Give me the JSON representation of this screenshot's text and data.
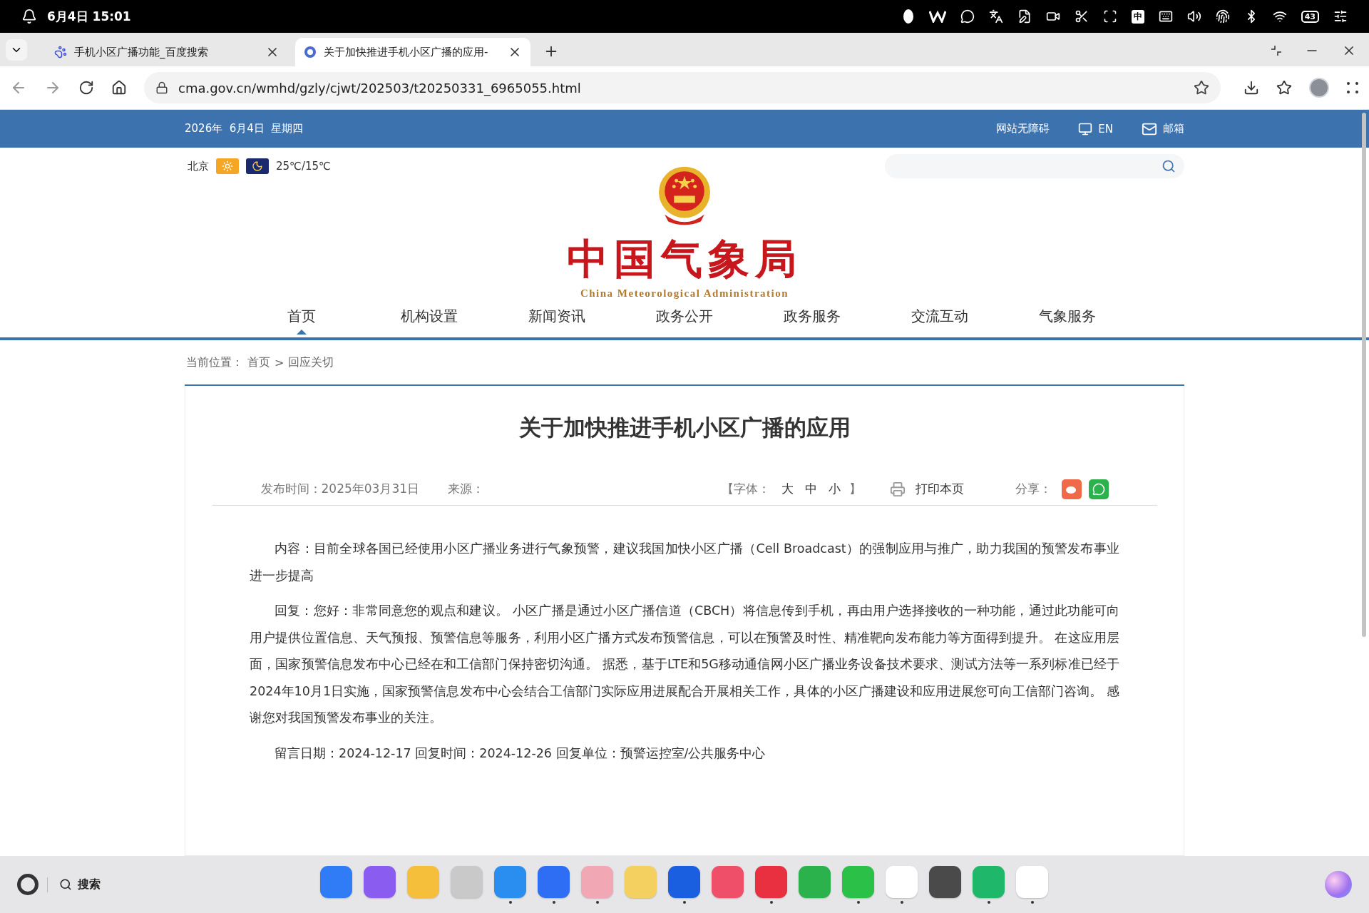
{
  "status_bar": {
    "time": "6月4日 15:01",
    "ime": "中",
    "battery": "43"
  },
  "browser": {
    "tabs": [
      {
        "title": "手机小区广播功能_百度搜索",
        "kind": "paw",
        "selected": false
      },
      {
        "title": "关于加快推进手机小区广播的应用-",
        "kind": "site",
        "selected": true
      }
    ],
    "url": "cma.gov.cn/wmhd/gzly/cjwt/202503/t20250331_6965055.html"
  },
  "site": {
    "date": "2026年  6月4日  星期四",
    "top_links": [
      {
        "label": "网站无障碍",
        "kind": "text"
      },
      {
        "label": "EN",
        "kind": "screen"
      },
      {
        "label": "邮箱",
        "kind": "mail"
      }
    ],
    "city": "北京",
    "temperature": "25℃/15℃",
    "logo": {
      "title": "中国气象局",
      "subtitle": "China Meteorological Administration"
    },
    "nav": [
      {
        "label": "首页",
        "selected": true
      },
      {
        "label": "机构设置",
        "selected": false
      },
      {
        "label": "新闻资讯",
        "selected": false
      },
      {
        "label": "政务公开",
        "selected": false
      },
      {
        "label": "政务服务",
        "selected": false
      },
      {
        "label": "交流互动",
        "selected": false
      },
      {
        "label": "气象服务",
        "selected": false
      }
    ],
    "breadcrumb": {
      "label": "当前位置：",
      "items": [
        "首页",
        "回应关切"
      ],
      "separator": ">"
    }
  },
  "article": {
    "title": "关于加快推进手机小区广播的应用",
    "published": "发布时间：2025年03月31日",
    "source": "来源：",
    "font_label": "【字体：",
    "font_sizes": [
      "大",
      "中",
      "小"
    ],
    "font_close": "】",
    "print": "打印本页",
    "share": "分享：",
    "paragraphs": [
      "内容：目前全球各国已经使用小区广播业务进行气象预警，建议我国加快小区广播（Cell Broadcast）的强制应用与推广，助力我国的预警发布事业进一步提高",
      "回复：您好：非常同意您的观点和建议。 小区广播是通过小区广播信道（CBCH）将信息传到手机，再由用户选择接收的一种功能，通过此功能可向用户提供位置信息、天气预报、预警信息等服务，利用小区广播方式发布预警信息，可以在预警及时性、精准靶向发布能力等方面得到提升。 在这应用层面，国家预警信息发布中心已经在和工信部门保持密切沟通。 据悉，基于LTE和5G移动通信网小区广播业务设备技术要求、测试方法等一系列标准已经于2024年10月1日实施，国家预警信息发布中心会结合工信部门实际应用进展配合开展相关工作，具体的小区广播建设和应用进展您可向工信部门咨询。 感谢您对我国预警发布事业的关注。",
      "留言日期：2024-12-17  回复时间：2024-12-26  回复单位：预警运控室/公共服务中心"
    ]
  },
  "dock": {
    "search": "搜索",
    "apps": [
      {
        "color": "#2f7cf6",
        "running": false
      },
      {
        "color": "#8a5cf0",
        "running": false
      },
      {
        "color": "#f5bf3c",
        "running": false
      },
      {
        "color": "#c9c9c9",
        "running": false
      },
      {
        "color": "#2a8df0",
        "running": true
      },
      {
        "color": "#2d6ef5",
        "running": true
      },
      {
        "color": "#f2a7b5",
        "running": true
      },
      {
        "color": "#f3d060",
        "running": false
      },
      {
        "color": "#1a5fe0",
        "running": true
      },
      {
        "color": "#f04f6a",
        "running": false
      },
      {
        "color": "#e83040",
        "running": true
      },
      {
        "color": "#2bb24c",
        "running": false
      },
      {
        "color": "#2bc048",
        "running": true
      },
      {
        "color": "#ffffff",
        "running": true
      },
      {
        "color": "#4a4a4a",
        "running": false
      },
      {
        "color": "#1fb86a",
        "running": true
      },
      {
        "color": "#ffffff",
        "running": true
      }
    ]
  }
}
